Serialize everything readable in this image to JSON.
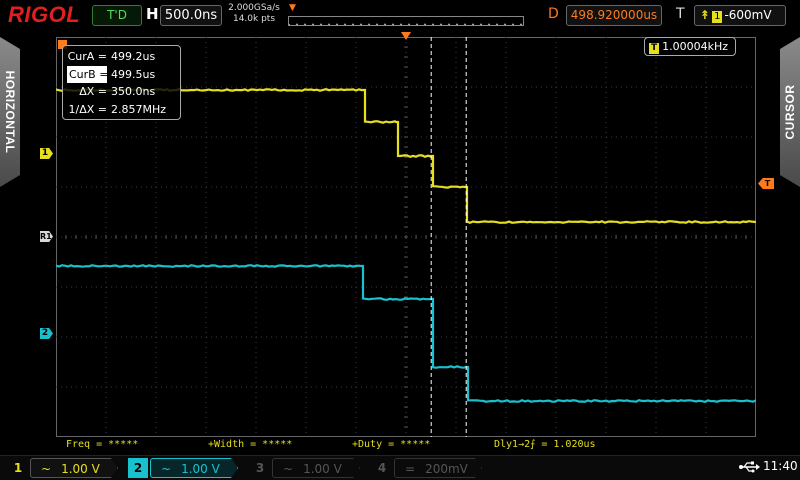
{
  "top": {
    "brand": "RIGOL",
    "trigger_status": "T'D",
    "h_label": "H",
    "timebase": "500.0ns",
    "sample_rate": "2.000GSa/s",
    "memory_depth": "14.0k pts",
    "d_label": "D",
    "delay": "498.920000us",
    "t_label": "T",
    "trigger_source": "1",
    "trigger_level": "-600mV"
  },
  "side_tabs": {
    "left": "HORIZONTAL",
    "right": "CURSOR"
  },
  "markers": {
    "ch1": "1",
    "ch2": "2",
    "r1": "R1",
    "trig": "T"
  },
  "cursor": {
    "rows": [
      {
        "label": "CurA =",
        "value": "499.2us",
        "selected": false
      },
      {
        "label": "CurB =",
        "value": "499.5us",
        "selected": true
      },
      {
        "label": "ΔX =",
        "value": "350.0ns",
        "selected": false
      },
      {
        "label": "1/ΔX =",
        "value": "2.857MHz",
        "selected": false
      }
    ],
    "cur_a_fraction": 0.536,
    "cur_b_fraction": 0.586
  },
  "trigger_freq": {
    "badge": "T",
    "value": "1.00004kHz"
  },
  "measurements": {
    "freq": "Freq = *****",
    "width": "+Width = *****",
    "duty": "+Duty = *****",
    "delay": "Dly1→2⨍ = 1.020us"
  },
  "channels": [
    {
      "num": "1",
      "coupling": "~",
      "scale": "1.00 V",
      "color": "#e6df1e",
      "active": true
    },
    {
      "num": "2",
      "coupling": "~",
      "scale": "1.00 V",
      "color": "#19c1cf",
      "active": true
    },
    {
      "num": "3",
      "coupling": "~",
      "scale": "1.00 V",
      "color": "#555555",
      "active": false
    },
    {
      "num": "4",
      "coupling": "=",
      "scale": "200mV",
      "color": "#555555",
      "active": false
    }
  ],
  "clock": "11:40",
  "colors": {
    "ch1": "#e6df1e",
    "ch2": "#19c1cf",
    "trigger": "#ff7a1a",
    "grid": "#3a3a3a"
  }
}
